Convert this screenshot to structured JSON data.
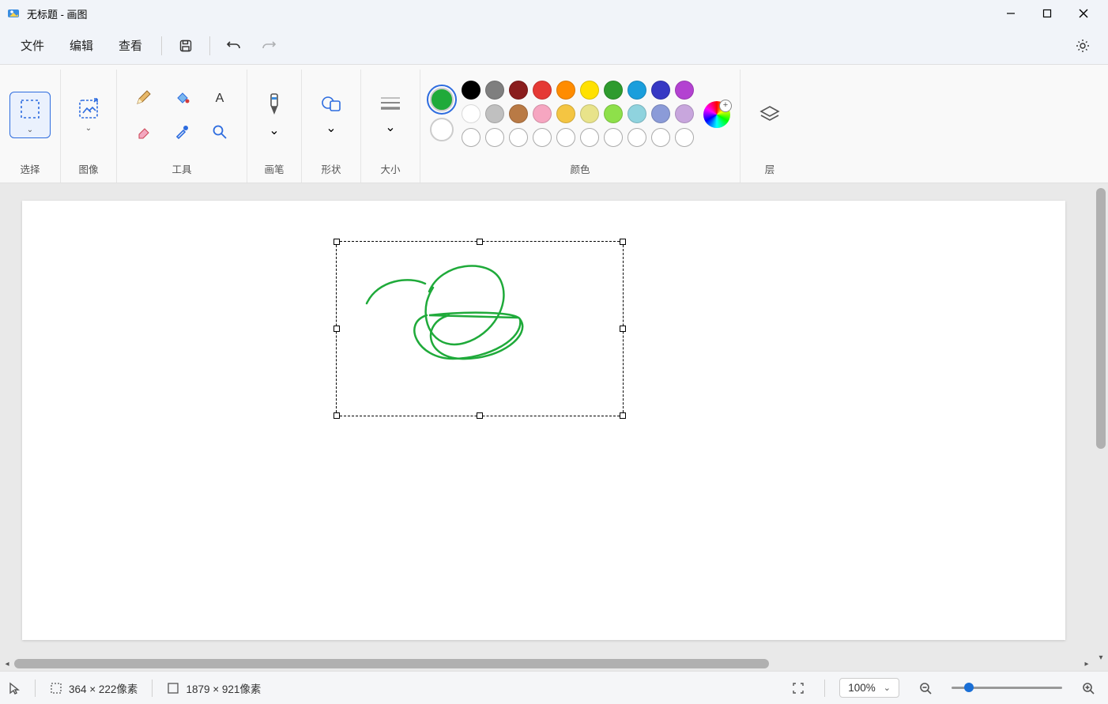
{
  "window": {
    "title": "无标题 - 画图"
  },
  "menu": {
    "file": "文件",
    "edit": "编辑",
    "view": "查看"
  },
  "groups": {
    "select": "选择",
    "image": "图像",
    "tools": "工具",
    "brush": "画笔",
    "shape": "形状",
    "size": "大小",
    "color": "颜色",
    "layer": "层"
  },
  "colors": {
    "primary": "#1faa3a",
    "secondary": "#ffffff",
    "row1": [
      "#000000",
      "#7f7f7f",
      "#8a1d1d",
      "#e53935",
      "#ff8c00",
      "#ffe100",
      "#2e9b2e",
      "#1a9edc",
      "#3638c4",
      "#b342d1"
    ],
    "row2": [
      "#ffffff",
      "#c0c0c0",
      "#b97a45",
      "#f6a6c1",
      "#f4c542",
      "#e8e38a",
      "#8ee04a",
      "#8fd3de",
      "#8b9bd8",
      "#c8a6dd"
    ]
  },
  "selection": {
    "dimensions": "364 × 222像素"
  },
  "canvas": {
    "dimensions": "1879 × 921像素"
  },
  "zoom": {
    "value": "100%"
  }
}
